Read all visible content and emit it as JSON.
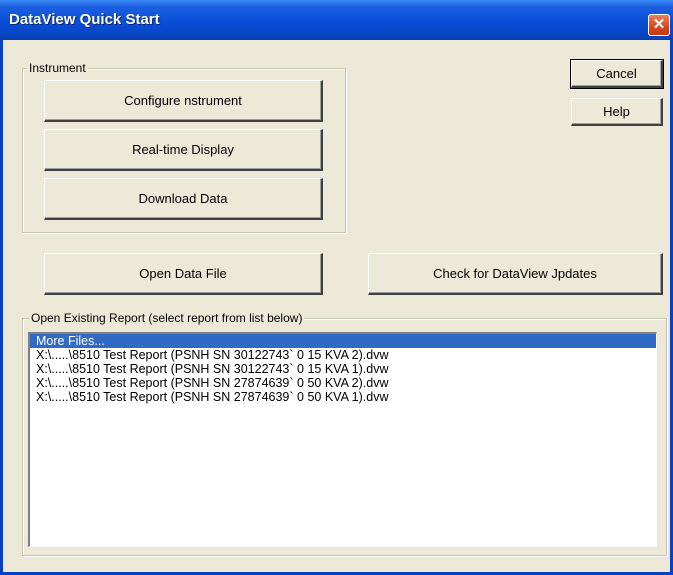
{
  "window": {
    "title": "DataView Quick Start",
    "close_symbol": "✕"
  },
  "instrument_group": {
    "label": "Instrument",
    "configure_button": "Configure nstrument",
    "realtime_button": "Real-time Display",
    "download_button": "Download Data"
  },
  "side_buttons": {
    "cancel": "Cancel",
    "help": "Help"
  },
  "actions": {
    "open_data_file": "Open Data File",
    "check_updates": "Check for DataView Jpdates"
  },
  "reports_group": {
    "label": "Open Existing Report (select report from list below)",
    "items": [
      {
        "text": "More Files...",
        "selected": true
      },
      {
        "text": "X:\\.....\\8510 Test Report (PSNH SN 30122743` 0 15 KVA 2).dvw",
        "selected": false
      },
      {
        "text": "X:\\.....\\8510 Test Report (PSNH SN 30122743` 0 15 KVA 1).dvw",
        "selected": false
      },
      {
        "text": "X:\\.....\\8510 Test Report (PSNH SN 27874639` 0 50 KVA 2).dvw",
        "selected": false
      },
      {
        "text": "X:\\.....\\8510 Test Report (PSNH SN 27874639` 0 50 KVA 1).dvw",
        "selected": false
      }
    ]
  }
}
